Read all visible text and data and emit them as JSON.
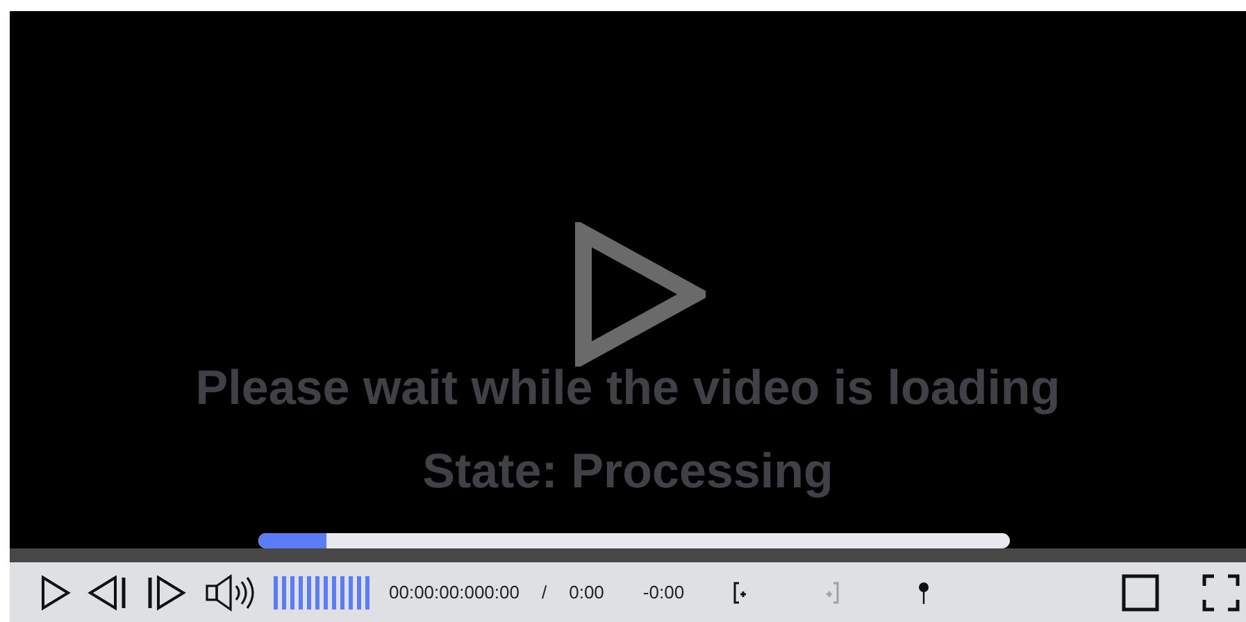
{
  "video": {
    "message": "Please wait while the video is loading",
    "state_text": "State: Processing",
    "loading": {
      "level": 0.09
    }
  },
  "controls": {
    "volume": {
      "level": 1
    },
    "timecode": "00:00:00:000:00",
    "separator": "/",
    "current_time": "0:00",
    "remaining_time": "-0:00",
    "mark_in": {
      "disabled": false
    },
    "mark_out": {
      "disabled": true
    }
  }
}
